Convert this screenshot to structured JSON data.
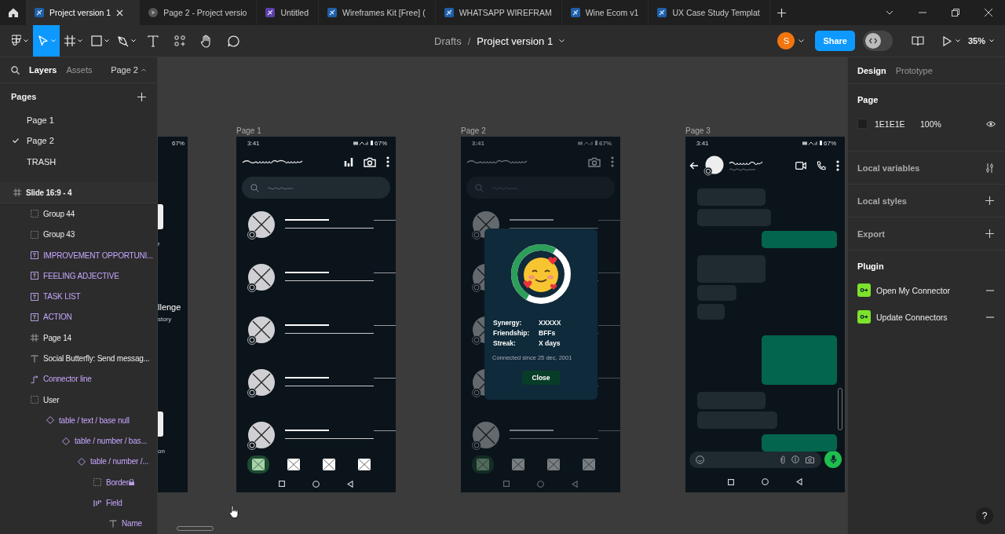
{
  "tabs": [
    {
      "label": "Project version 1",
      "kind": "design",
      "selected": true
    },
    {
      "label": "Page 2 - Project versio",
      "kind": "prototype",
      "selected": false
    },
    {
      "label": "Untitled",
      "kind": "figjam",
      "selected": false
    },
    {
      "label": "Wireframes Kit [Free] (",
      "kind": "design",
      "selected": false
    },
    {
      "label": "WHATSAPP WIREFRAM",
      "kind": "design",
      "selected": false
    },
    {
      "label": "Wine Ecom v1",
      "kind": "design",
      "selected": false
    },
    {
      "label": "UX Case Study Templat",
      "kind": "design",
      "selected": false
    }
  ],
  "toolbar": {
    "tools": [
      {
        "kind": "menu",
        "caret": true,
        "selected": false
      },
      {
        "kind": "move",
        "caret": true,
        "selected": true
      },
      {
        "kind": "frame",
        "caret": true,
        "selected": false
      },
      {
        "kind": "shape",
        "caret": true,
        "selected": false
      },
      {
        "kind": "pen",
        "caret": true,
        "selected": false
      },
      {
        "kind": "text",
        "caret": false,
        "selected": false
      },
      {
        "kind": "components",
        "caret": false,
        "selected": false
      },
      {
        "kind": "hand",
        "caret": false,
        "selected": false
      },
      {
        "kind": "comment",
        "caret": false,
        "selected": false
      }
    ],
    "breadcrumb": {
      "folder": "Drafts",
      "separator": "/",
      "file": "Project version 1"
    },
    "avatar": "S",
    "share": "Share",
    "dev_mode": {
      "on": false
    },
    "zoom": "35%"
  },
  "left_panel": {
    "tabs": [
      {
        "label": "Layers",
        "selected": true
      },
      {
        "label": "Assets",
        "selected": false
      }
    ],
    "page_menu": "Page 2",
    "pages_title": "Pages",
    "pages": [
      {
        "label": "Page 1",
        "selected": false
      },
      {
        "label": "Page 2",
        "selected": true
      },
      {
        "label": "TRASH",
        "selected": false
      }
    ],
    "layers": [
      {
        "label": "Slide 16:9 - 4",
        "kind": "frame",
        "component": false,
        "locked": false,
        "highlighted": true,
        "children": [
          {
            "label": "Group 44",
            "kind": "group",
            "component": false,
            "locked": false,
            "highlighted": false
          },
          {
            "label": "Group 43",
            "kind": "group",
            "component": false,
            "locked": false,
            "highlighted": false
          },
          {
            "label": "IMPROVEMENT OPPORTUNI...",
            "kind": "text-block",
            "component": true,
            "locked": false,
            "highlighted": false
          },
          {
            "label": "FEELING ADJECTIVE",
            "kind": "text-block",
            "component": true,
            "locked": false,
            "highlighted": false
          },
          {
            "label": "TASK LIST",
            "kind": "text-block",
            "component": true,
            "locked": false,
            "highlighted": false
          },
          {
            "label": "ACTION",
            "kind": "text-block",
            "component": true,
            "locked": false,
            "highlighted": false
          },
          {
            "label": "Page 14",
            "kind": "frame",
            "component": false,
            "locked": false,
            "highlighted": false
          },
          {
            "label": "Social Butterfly: Send messag...",
            "kind": "text",
            "component": false,
            "locked": false,
            "highlighted": false
          },
          {
            "label": "Connector line",
            "kind": "connector",
            "component": true,
            "locked": false,
            "highlighted": false
          },
          {
            "label": "User",
            "kind": "group",
            "component": false,
            "locked": false,
            "highlighted": false,
            "children": [
              {
                "label": "table / text / base null",
                "kind": "instance",
                "component": true,
                "locked": false,
                "highlighted": false,
                "children": [
                  {
                    "label": "table / number / bas...",
                    "kind": "instance",
                    "component": true,
                    "locked": false,
                    "highlighted": false,
                    "children": [
                      {
                        "label": "table / number /...",
                        "kind": "instance",
                        "component": true,
                        "locked": false,
                        "highlighted": false,
                        "children": [
                          {
                            "label": "Border",
                            "kind": "group",
                            "component": true,
                            "locked": true,
                            "highlighted": false
                          },
                          {
                            "label": "Field",
                            "kind": "layout",
                            "component": true,
                            "locked": false,
                            "highlighted": false,
                            "children": [
                              {
                                "label": "Name",
                                "kind": "text",
                                "component": true,
                                "locked": false,
                                "highlighted": false
                              }
                            ]
                          }
                        ]
                      }
                    ]
                  }
                ]
              }
            ]
          }
        ]
      }
    ]
  },
  "canvas": {
    "partial_frame": {
      "battery": "67%",
      "texts": [
        "r",
        "llenge",
        "story",
        "on"
      ]
    },
    "frames": [
      {
        "label": "Page 1",
        "kind": "list",
        "dimmed": false,
        "time": "3:41",
        "battery": "67%",
        "rows": [
          {
            "kind": "contact"
          },
          {
            "kind": "contact"
          },
          {
            "kind": "contact"
          },
          {
            "kind": "contact"
          },
          {
            "kind": "contact"
          }
        ],
        "nav": [
          {
            "selected": true
          },
          {
            "selected": false
          },
          {
            "selected": false
          },
          {
            "selected": false
          }
        ]
      },
      {
        "label": "Page 2",
        "kind": "list",
        "dimmed": true,
        "time": "3:41",
        "battery": "67%",
        "rows": [
          {
            "kind": "contact"
          },
          {
            "kind": "contact"
          },
          {
            "kind": "contact"
          },
          {
            "kind": "contact"
          },
          {
            "kind": "contact"
          }
        ],
        "nav": [
          {
            "selected": true
          },
          {
            "selected": false
          },
          {
            "selected": false
          },
          {
            "selected": false
          }
        ],
        "popup": {
          "level": 0.5,
          "stats": [
            {
              "label": "Synergy:",
              "value": "XXXXX"
            },
            {
              "label": "Friendship:",
              "value": "BFFs"
            },
            {
              "label": "Streak:",
              "value": "X days"
            }
          ],
          "note": "Connected since 25 dec, 2001",
          "button": "Close"
        }
      },
      {
        "label": "Page 3",
        "kind": "chat",
        "dimmed": false,
        "time": "3:41",
        "battery": "67%",
        "bubbles": [
          {
            "kind": "in"
          },
          {
            "kind": "in"
          },
          {
            "kind": "out"
          },
          {
            "kind": "in"
          },
          {
            "kind": "in"
          },
          {
            "kind": "in"
          },
          {
            "kind": "out"
          },
          {
            "kind": "in"
          },
          {
            "kind": "in"
          },
          {
            "kind": "out"
          }
        ]
      }
    ]
  },
  "right_panel": {
    "tabs": [
      {
        "label": "Design",
        "selected": true
      },
      {
        "label": "Prototype",
        "selected": false
      }
    ],
    "page": {
      "title": "Page",
      "hex": "1E1E1E",
      "opacity": "100%"
    },
    "sections": [
      {
        "label": "Local variables",
        "kind": "variables"
      },
      {
        "label": "Local styles",
        "kind": "add"
      },
      {
        "label": "Export",
        "kind": "add"
      }
    ],
    "plugin": {
      "title": "Plugin",
      "items": [
        "Open My Connector",
        "Update Connectors"
      ]
    },
    "help": "?"
  }
}
